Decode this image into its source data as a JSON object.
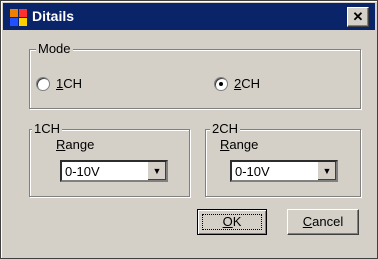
{
  "window": {
    "title": "Ditails",
    "close_glyph": "✕"
  },
  "mode": {
    "legend": "Mode",
    "options": [
      {
        "label": "1CH",
        "mnemonic": "1",
        "rest": "CH",
        "checked": false
      },
      {
        "label": "2CH",
        "mnemonic": "2",
        "rest": "CH",
        "checked": true
      }
    ]
  },
  "ch1": {
    "legend": "1CH",
    "range_label_mnemonic": "R",
    "range_label_rest": "ange",
    "range_value": "0-10V"
  },
  "ch2": {
    "legend": "2CH",
    "range_label_mnemonic": "R",
    "range_label_rest": "ange",
    "range_value": "0-10V"
  },
  "buttons": {
    "ok_mnemonic": "O",
    "ok_rest": "K",
    "cancel_mnemonic": "C",
    "cancel_rest": "ancel"
  },
  "icons": {
    "app": "app-icon",
    "close": "close-icon",
    "dropdown": "dropdown-arrow-icon"
  }
}
